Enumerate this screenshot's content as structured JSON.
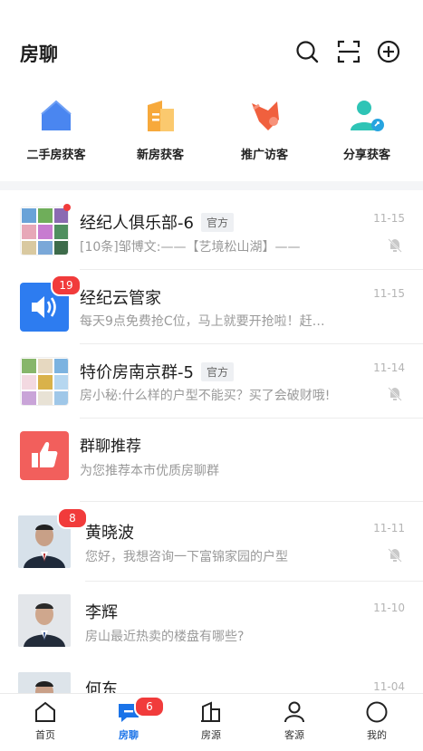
{
  "header": {
    "title": "房聊"
  },
  "quick_actions": [
    {
      "label": "二手房获客",
      "icon": "house-icon",
      "color": "#4a86f0"
    },
    {
      "label": "新房获客",
      "icon": "building-icon",
      "color": "#f7a93b"
    },
    {
      "label": "推广访客",
      "icon": "promote-icon",
      "color": "#f0603e"
    },
    {
      "label": "分享获客",
      "icon": "share-user-icon",
      "color": "#2ec4b6"
    }
  ],
  "chats": [
    {
      "name": "经纪人俱乐部-6",
      "tag": "官方",
      "time": "11-15",
      "preview": "[10条]邹博文:——【艺境松山湖】——",
      "muted": true
    },
    {
      "name": "经纪云管家",
      "time": "11-15",
      "preview": "每天9点免费抢C位，马上就要开抢啦！赶…",
      "badge": "19"
    },
    {
      "name": "特价房南京群-5",
      "tag": "官方",
      "time": "11-14",
      "preview": "房小秘:什么样的户型不能买？买了会破财哦!",
      "muted": true
    },
    {
      "name": "群聊推荐",
      "preview": "为您推荐本市优质房聊群"
    },
    {
      "name": "黄晓波",
      "time": "11-11",
      "preview": "您好，我想咨询一下富锦家园的户型",
      "badge": "8",
      "muted": true
    },
    {
      "name": "李辉",
      "time": "11-10",
      "preview": "房山最近热卖的楼盘有哪些?"
    },
    {
      "name": "何东",
      "time": "11-04"
    }
  ],
  "tabbar": {
    "items": [
      {
        "label": "首页"
      },
      {
        "label": "房聊",
        "badge": "6",
        "active": true
      },
      {
        "label": "房源"
      },
      {
        "label": "客源"
      },
      {
        "label": "我的"
      }
    ]
  },
  "colors": {
    "accent": "#1a73e8",
    "badge": "#f13b3b"
  }
}
